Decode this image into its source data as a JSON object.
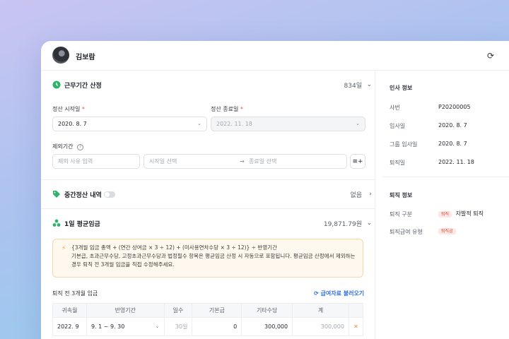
{
  "header": {
    "name": "김보람"
  },
  "sections": {
    "work_period": {
      "title": "근무기간 산정",
      "value": "834일"
    },
    "interim": {
      "title": "중간정산 내역",
      "value": "없음"
    },
    "avg_wage": {
      "title": "1일 평균임금",
      "value": "19,871.79원"
    }
  },
  "form": {
    "start_label": "정산 시작일",
    "end_label": "정산 종료일",
    "required_mark": "*",
    "start_value": "2020. 8. 7",
    "end_value": "2022. 11. 18",
    "exclude_label": "제외기간",
    "exclude_reason_placeholder": "제외 사유 입력",
    "start_pick_placeholder": "시작일 선택",
    "end_pick_placeholder": "종료일 선택",
    "arrow": "→"
  },
  "notice": {
    "formula": "{3개월 임금 총액 + (연간 상여금 × 3 ÷ 12) + (미사용연차수당 × 3 ÷ 12)} ÷ 반영기간",
    "desc": "기본급, 초과근무수당, 고정초과근무수당과 법정필수 항목은 평균임금 산정 시 자동으로 포함됩니다. 평균임금 산정에서 제외하는 경우 퇴직 전 3개월 임금을 직접 수정해주세요."
  },
  "wage_table": {
    "title": "퇴직 전 3개월 임금",
    "load_button": "급여자료 불러오기",
    "columns": [
      "귀속월",
      "반영기간",
      "일수",
      "기본급",
      "기타수당",
      "계"
    ],
    "rows": [
      {
        "month": "2022. 9",
        "period": "9. 1 ~ 9. 30",
        "days": "30일",
        "base": "0",
        "other": "300,000",
        "total": "300,000"
      }
    ]
  },
  "hr_info": {
    "title": "인사 정보",
    "fields": [
      {
        "label": "사번",
        "value": "P20200005"
      },
      {
        "label": "입사일",
        "value": "2020. 8. 7"
      },
      {
        "label": "그룹 입사일",
        "value": "2020. 8. 7"
      },
      {
        "label": "퇴직일",
        "value": "2022. 11. 18"
      }
    ]
  },
  "retire_info": {
    "title": "퇴직 정보",
    "type_label": "퇴직 구분",
    "type_badge": "퇴직",
    "type_value": "자발적 퇴직",
    "pay_label": "퇴직급여 유형",
    "pay_badge": "퇴직금"
  },
  "colors": {
    "accent": "#2f6fe0",
    "warn_bg": "#fff8ee",
    "badge_red": "#d44a3f"
  }
}
